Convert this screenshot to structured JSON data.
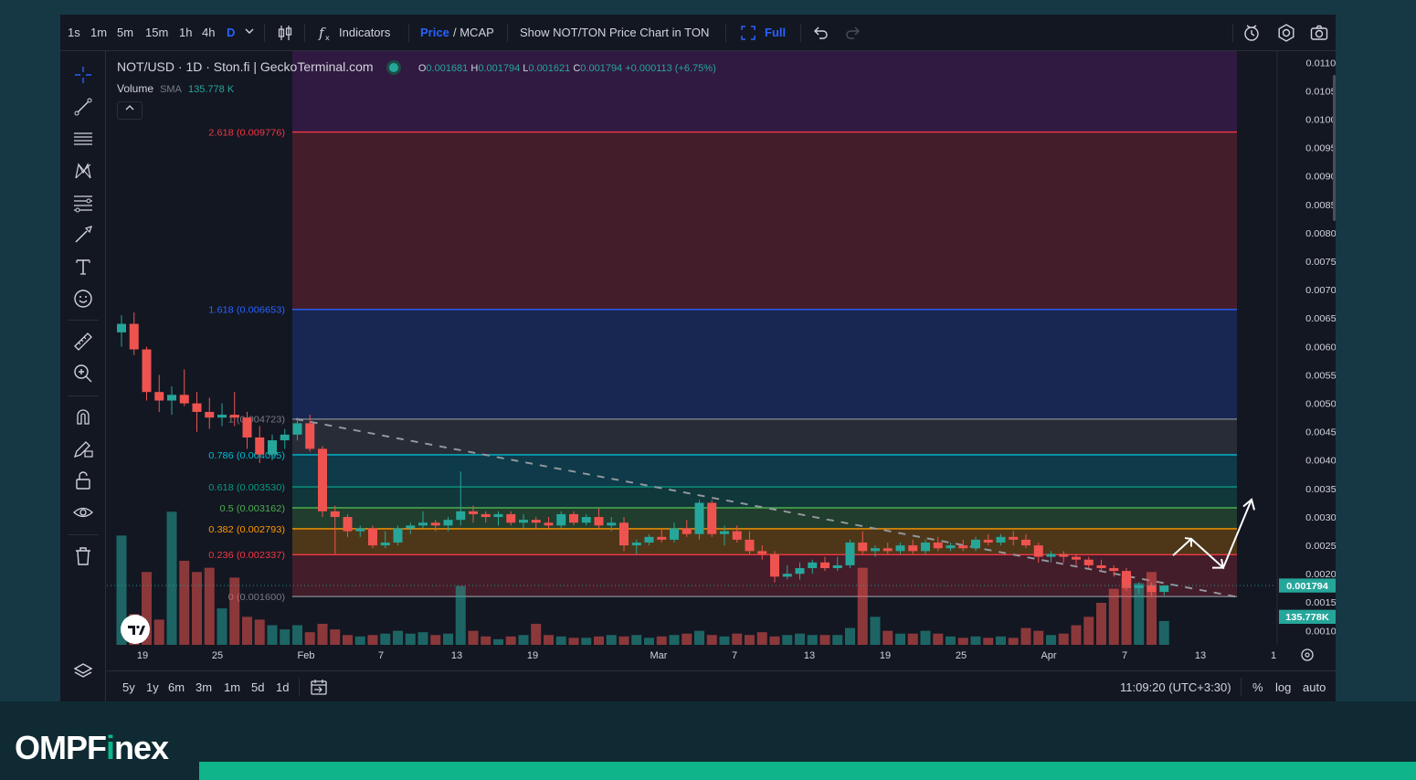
{
  "brand": {
    "name_prefix": "OMPF",
    "name_i": "i",
    "name_suffix": "nex"
  },
  "toolbar": {
    "intervals": [
      "1s",
      "1m",
      "5m",
      "15m",
      "1h",
      "4h",
      "D"
    ],
    "active_interval": "D",
    "indicators_label": "Indicators",
    "price_label": "Price",
    "mcap_label": "/ MCAP",
    "show_ton_label": "Show NOT/TON Price Chart in TON",
    "full_label": "Full"
  },
  "legend": {
    "symbol": "NOT/USD · 1D · Ston.fi | GeckoTerminal.com",
    "o_label": "O",
    "o_value": "0.001681",
    "h_label": "H",
    "h_value": "0.001794",
    "l_label": "L",
    "l_value": "0.001621",
    "c_label": "C",
    "c_value": "0.001794",
    "change": "+0.000113 (+6.75%)",
    "volume_label": "Volume",
    "sma_label": "SMA",
    "volume_value": "135.778 K"
  },
  "bottombar": {
    "ranges": [
      "5y",
      "1y",
      "6m",
      "3m",
      "1m",
      "5d",
      "1d"
    ],
    "clock": "11:09:20 (UTC+3:30)",
    "percent_label": "%",
    "log_label": "log",
    "auto_label": "auto"
  },
  "colors": {
    "up": "#26a69a",
    "down": "#ef5350",
    "background": "#131722",
    "brand_accent": "#10b48a"
  },
  "icons": [
    "crosshair-icon",
    "trendline-icon",
    "horizontal-lines-icon",
    "pattern-icon",
    "fib-icon",
    "brush-icon",
    "text-icon",
    "emoji-icon",
    "ruler-icon",
    "zoom-in-icon",
    "magnet-icon",
    "pencil-lock-icon",
    "lock-icon",
    "eye-icon",
    "trash-icon",
    "layers-icon",
    "undo-icon",
    "redo-icon",
    "alert-icon",
    "settings-icon",
    "camera-icon",
    "calendar-icon",
    "fullscreen-icon",
    "candles-icon",
    "indicators-icon"
  ],
  "chart_data": {
    "type": "candlestick",
    "title": "NOT/USD · 1D · Ston.fi | GeckoTerminal.com",
    "x_tick_labels": [
      "19",
      "25",
      "Feb",
      "7",
      "13",
      "19",
      "Mar",
      "7",
      "13",
      "19",
      "25",
      "Apr",
      "7",
      "13",
      "1"
    ],
    "y_tick_labels": [
      "0.011000",
      "0.010500",
      "0.010000",
      "0.009500",
      "0.009000",
      "0.008500",
      "0.008000",
      "0.007500",
      "0.007000",
      "0.006500",
      "0.006000",
      "0.005500",
      "0.005000",
      "0.004500",
      "0.004000",
      "0.003500",
      "0.003000",
      "0.002500",
      "0.002000",
      "0.001500",
      "0.001000"
    ],
    "ylim": [
      0.00075,
      0.0112
    ],
    "last_price_label": "0.001794",
    "volume_sma_label": "135.778K",
    "fib_levels": [
      {
        "label": "2.618 (0.009776)",
        "value": 0.009776,
        "color": "#f23645"
      },
      {
        "label": "1.618 (0.006653)",
        "value": 0.006653,
        "color": "#2962ff"
      },
      {
        "label": "1 (0.004723)",
        "value": 0.004723,
        "color": "#787b86"
      },
      {
        "label": "0.786 (0.004095)",
        "value": 0.004095,
        "color": "#00bcd4"
      },
      {
        "label": "0.618 (0.003530)",
        "value": 0.00353,
        "color": "#089981"
      },
      {
        "label": "0.5 (0.003162)",
        "value": 0.003162,
        "color": "#4caf50"
      },
      {
        "label": "0.382 (0.002793)",
        "value": 0.002793,
        "color": "#ff9800"
      },
      {
        "label": "0.236 (0.002337)",
        "value": 0.002337,
        "color": "#f23645"
      },
      {
        "label": "0 (0.001600)",
        "value": 0.0016,
        "color": "#787b86"
      }
    ],
    "candles": [
      {
        "o": 0.00625,
        "h": 0.00655,
        "l": 0.006,
        "c": 0.0064,
        "v": 0.78
      },
      {
        "o": 0.0064,
        "h": 0.0066,
        "l": 0.00585,
        "c": 0.00595,
        "v": 0.22
      },
      {
        "o": 0.00595,
        "h": 0.006,
        "l": 0.00505,
        "c": 0.0052,
        "v": 0.52
      },
      {
        "o": 0.0052,
        "h": 0.0055,
        "l": 0.00485,
        "c": 0.00505,
        "v": 0.18
      },
      {
        "o": 0.00505,
        "h": 0.0053,
        "l": 0.0048,
        "c": 0.00515,
        "v": 0.95
      },
      {
        "o": 0.00515,
        "h": 0.0056,
        "l": 0.00495,
        "c": 0.005,
        "v": 0.6
      },
      {
        "o": 0.005,
        "h": 0.0052,
        "l": 0.0045,
        "c": 0.00485,
        "v": 0.52
      },
      {
        "o": 0.00485,
        "h": 0.0051,
        "l": 0.00455,
        "c": 0.00475,
        "v": 0.55
      },
      {
        "o": 0.00475,
        "h": 0.005,
        "l": 0.0046,
        "c": 0.0048,
        "v": 0.26
      },
      {
        "o": 0.0048,
        "h": 0.0052,
        "l": 0.0046,
        "c": 0.00475,
        "v": 0.48
      },
      {
        "o": 0.00475,
        "h": 0.00485,
        "l": 0.0042,
        "c": 0.0044,
        "v": 0.2
      },
      {
        "o": 0.0044,
        "h": 0.0046,
        "l": 0.00395,
        "c": 0.0041,
        "v": 0.18
      },
      {
        "o": 0.0041,
        "h": 0.00445,
        "l": 0.004,
        "c": 0.00435,
        "v": 0.14
      },
      {
        "o": 0.00435,
        "h": 0.00455,
        "l": 0.0042,
        "c": 0.00445,
        "v": 0.11
      },
      {
        "o": 0.00445,
        "h": 0.00475,
        "l": 0.00435,
        "c": 0.00465,
        "v": 0.14
      },
      {
        "o": 0.00465,
        "h": 0.0048,
        "l": 0.00415,
        "c": 0.0042,
        "v": 0.09
      },
      {
        "o": 0.0042,
        "h": 0.00425,
        "l": 0.003,
        "c": 0.0031,
        "v": 0.15
      },
      {
        "o": 0.0031,
        "h": 0.0032,
        "l": 0.00235,
        "c": 0.003,
        "v": 0.11
      },
      {
        "o": 0.003,
        "h": 0.00305,
        "l": 0.00265,
        "c": 0.00275,
        "v": 0.07
      },
      {
        "o": 0.00275,
        "h": 0.00285,
        "l": 0.00265,
        "c": 0.0028,
        "v": 0.06
      },
      {
        "o": 0.0028,
        "h": 0.00285,
        "l": 0.00245,
        "c": 0.0025,
        "v": 0.07
      },
      {
        "o": 0.0025,
        "h": 0.00275,
        "l": 0.00245,
        "c": 0.00255,
        "v": 0.08
      },
      {
        "o": 0.00255,
        "h": 0.00285,
        "l": 0.0025,
        "c": 0.0028,
        "v": 0.1
      },
      {
        "o": 0.0028,
        "h": 0.0029,
        "l": 0.0027,
        "c": 0.00285,
        "v": 0.08
      },
      {
        "o": 0.00285,
        "h": 0.0031,
        "l": 0.0028,
        "c": 0.0029,
        "v": 0.09
      },
      {
        "o": 0.0029,
        "h": 0.00295,
        "l": 0.00275,
        "c": 0.00285,
        "v": 0.07
      },
      {
        "o": 0.00285,
        "h": 0.003,
        "l": 0.00275,
        "c": 0.00295,
        "v": 0.08
      },
      {
        "o": 0.00295,
        "h": 0.0038,
        "l": 0.00285,
        "c": 0.0031,
        "v": 0.42
      },
      {
        "o": 0.0031,
        "h": 0.0032,
        "l": 0.0029,
        "c": 0.00305,
        "v": 0.1
      },
      {
        "o": 0.00305,
        "h": 0.0031,
        "l": 0.0029,
        "c": 0.003,
        "v": 0.06
      },
      {
        "o": 0.003,
        "h": 0.0031,
        "l": 0.00285,
        "c": 0.00305,
        "v": 0.04
      },
      {
        "o": 0.00305,
        "h": 0.0031,
        "l": 0.00285,
        "c": 0.0029,
        "v": 0.06
      },
      {
        "o": 0.0029,
        "h": 0.00305,
        "l": 0.0028,
        "c": 0.00295,
        "v": 0.07
      },
      {
        "o": 0.00295,
        "h": 0.003,
        "l": 0.0028,
        "c": 0.0029,
        "v": 0.15
      },
      {
        "o": 0.0029,
        "h": 0.003,
        "l": 0.0028,
        "c": 0.00285,
        "v": 0.07
      },
      {
        "o": 0.00285,
        "h": 0.0031,
        "l": 0.0028,
        "c": 0.00305,
        "v": 0.06
      },
      {
        "o": 0.00305,
        "h": 0.0031,
        "l": 0.00285,
        "c": 0.0029,
        "v": 0.05
      },
      {
        "o": 0.0029,
        "h": 0.00305,
        "l": 0.00285,
        "c": 0.003,
        "v": 0.05
      },
      {
        "o": 0.003,
        "h": 0.00315,
        "l": 0.0028,
        "c": 0.00285,
        "v": 0.06
      },
      {
        "o": 0.00285,
        "h": 0.003,
        "l": 0.00275,
        "c": 0.0029,
        "v": 0.07
      },
      {
        "o": 0.0029,
        "h": 0.003,
        "l": 0.0024,
        "c": 0.0025,
        "v": 0.06
      },
      {
        "o": 0.0025,
        "h": 0.0026,
        "l": 0.00235,
        "c": 0.00255,
        "v": 0.07
      },
      {
        "o": 0.00255,
        "h": 0.0027,
        "l": 0.0025,
        "c": 0.00265,
        "v": 0.05
      },
      {
        "o": 0.00265,
        "h": 0.0028,
        "l": 0.00255,
        "c": 0.0026,
        "v": 0.06
      },
      {
        "o": 0.0026,
        "h": 0.0029,
        "l": 0.00255,
        "c": 0.0028,
        "v": 0.07
      },
      {
        "o": 0.0028,
        "h": 0.00295,
        "l": 0.00265,
        "c": 0.0027,
        "v": 0.08
      },
      {
        "o": 0.0027,
        "h": 0.0033,
        "l": 0.0026,
        "c": 0.00325,
        "v": 0.1
      },
      {
        "o": 0.00325,
        "h": 0.0033,
        "l": 0.00265,
        "c": 0.0027,
        "v": 0.07
      },
      {
        "o": 0.0027,
        "h": 0.00285,
        "l": 0.0025,
        "c": 0.00275,
        "v": 0.06
      },
      {
        "o": 0.00275,
        "h": 0.00285,
        "l": 0.00255,
        "c": 0.0026,
        "v": 0.08
      },
      {
        "o": 0.0026,
        "h": 0.00275,
        "l": 0.00235,
        "c": 0.0024,
        "v": 0.07
      },
      {
        "o": 0.0024,
        "h": 0.0025,
        "l": 0.00225,
        "c": 0.00235,
        "v": 0.09
      },
      {
        "o": 0.00235,
        "h": 0.0024,
        "l": 0.00185,
        "c": 0.00195,
        "v": 0.06
      },
      {
        "o": 0.00195,
        "h": 0.00215,
        "l": 0.0019,
        "c": 0.002,
        "v": 0.07
      },
      {
        "o": 0.002,
        "h": 0.0022,
        "l": 0.0019,
        "c": 0.0021,
        "v": 0.08
      },
      {
        "o": 0.0021,
        "h": 0.00225,
        "l": 0.002,
        "c": 0.0022,
        "v": 0.07
      },
      {
        "o": 0.0022,
        "h": 0.0023,
        "l": 0.00205,
        "c": 0.0021,
        "v": 0.07
      },
      {
        "o": 0.0021,
        "h": 0.0023,
        "l": 0.00205,
        "c": 0.00215,
        "v": 0.07
      },
      {
        "o": 0.00215,
        "h": 0.0026,
        "l": 0.0021,
        "c": 0.00255,
        "v": 0.12
      },
      {
        "o": 0.00255,
        "h": 0.00275,
        "l": 0.00235,
        "c": 0.0024,
        "v": 0.55
      },
      {
        "o": 0.0024,
        "h": 0.0025,
        "l": 0.0023,
        "c": 0.00245,
        "v": 0.2
      },
      {
        "o": 0.00245,
        "h": 0.00255,
        "l": 0.00235,
        "c": 0.0024,
        "v": 0.1
      },
      {
        "o": 0.0024,
        "h": 0.00255,
        "l": 0.00235,
        "c": 0.0025,
        "v": 0.08
      },
      {
        "o": 0.0025,
        "h": 0.0026,
        "l": 0.00235,
        "c": 0.0024,
        "v": 0.08
      },
      {
        "o": 0.0024,
        "h": 0.0026,
        "l": 0.00235,
        "c": 0.00255,
        "v": 0.1
      },
      {
        "o": 0.00255,
        "h": 0.00265,
        "l": 0.0024,
        "c": 0.00245,
        "v": 0.08
      },
      {
        "o": 0.00245,
        "h": 0.00255,
        "l": 0.0024,
        "c": 0.0025,
        "v": 0.06
      },
      {
        "o": 0.0025,
        "h": 0.0026,
        "l": 0.0024,
        "c": 0.00245,
        "v": 0.05
      },
      {
        "o": 0.00245,
        "h": 0.00265,
        "l": 0.0024,
        "c": 0.0026,
        "v": 0.06
      },
      {
        "o": 0.0026,
        "h": 0.0027,
        "l": 0.0025,
        "c": 0.00255,
        "v": 0.05
      },
      {
        "o": 0.00255,
        "h": 0.0027,
        "l": 0.0025,
        "c": 0.00265,
        "v": 0.06
      },
      {
        "o": 0.00265,
        "h": 0.00275,
        "l": 0.0025,
        "c": 0.0026,
        "v": 0.05
      },
      {
        "o": 0.0026,
        "h": 0.0027,
        "l": 0.00245,
        "c": 0.0025,
        "v": 0.12
      },
      {
        "o": 0.0025,
        "h": 0.00255,
        "l": 0.0022,
        "c": 0.0023,
        "v": 0.1
      },
      {
        "o": 0.0023,
        "h": 0.0024,
        "l": 0.0022,
        "c": 0.00235,
        "v": 0.07
      },
      {
        "o": 0.00235,
        "h": 0.0024,
        "l": 0.0022,
        "c": 0.0023,
        "v": 0.08
      },
      {
        "o": 0.0023,
        "h": 0.00235,
        "l": 0.00215,
        "c": 0.00225,
        "v": 0.14
      },
      {
        "o": 0.00225,
        "h": 0.0023,
        "l": 0.0021,
        "c": 0.00215,
        "v": 0.2
      },
      {
        "o": 0.00215,
        "h": 0.00225,
        "l": 0.00205,
        "c": 0.0021,
        "v": 0.3
      },
      {
        "o": 0.0021,
        "h": 0.00215,
        "l": 0.00195,
        "c": 0.00205,
        "v": 0.4
      },
      {
        "o": 0.00205,
        "h": 0.0021,
        "l": 0.0017,
        "c": 0.00175,
        "v": 0.48
      },
      {
        "o": 0.00175,
        "h": 0.00185,
        "l": 0.00165,
        "c": 0.0018,
        "v": 0.44
      },
      {
        "o": 0.0018,
        "h": 0.00185,
        "l": 0.0016,
        "c": 0.00168,
        "v": 0.52
      },
      {
        "o": 0.001681,
        "h": 0.001794,
        "l": 0.001621,
        "c": 0.001794,
        "v": 0.17
      }
    ]
  }
}
